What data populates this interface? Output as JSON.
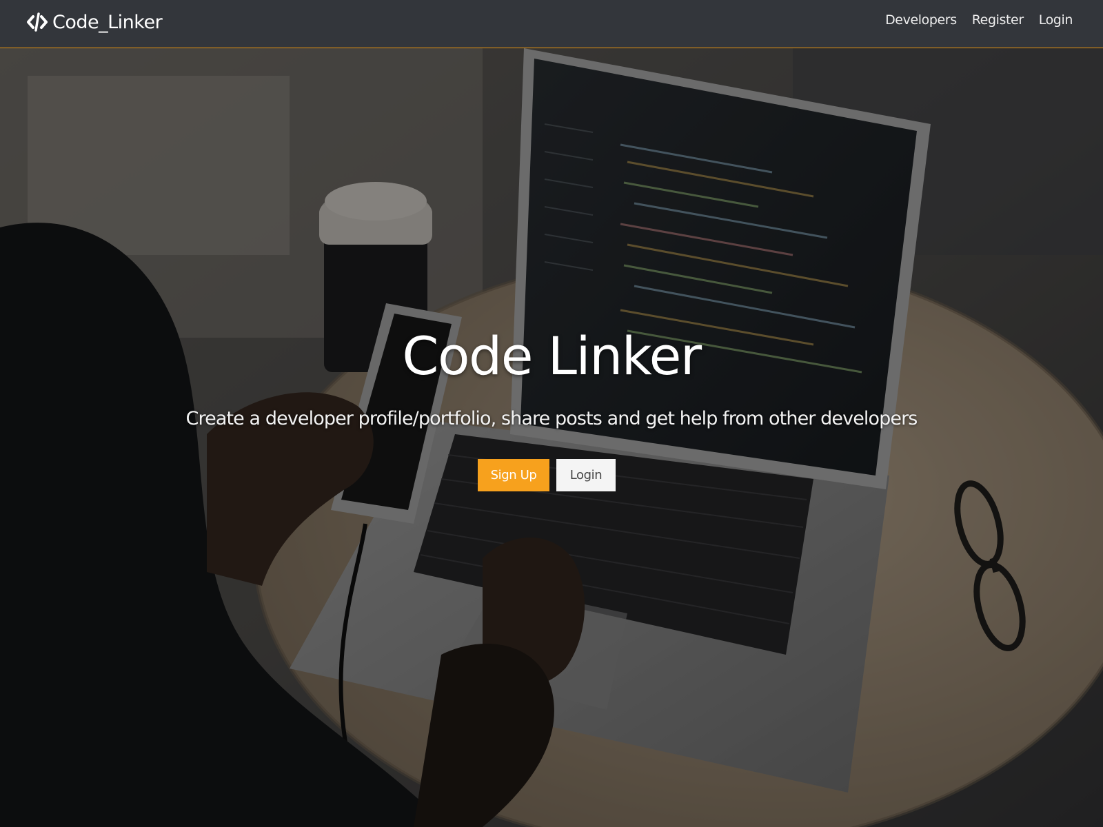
{
  "navbar": {
    "brand": "Code_Linker",
    "links": [
      {
        "label": "Developers"
      },
      {
        "label": "Register"
      },
      {
        "label": "Login"
      }
    ]
  },
  "hero": {
    "title": "Code Linker",
    "subtitle": "Create a developer profile/portfolio, share posts and get help from other developers",
    "buttons": {
      "signup_label": "Sign Up",
      "login_label": "Login"
    }
  },
  "colors": {
    "navbar_bg": "#33363b",
    "accent": "#f7a11d",
    "light_button": "#f4f4f4"
  },
  "icons": {
    "brand_icon": "code-icon"
  }
}
